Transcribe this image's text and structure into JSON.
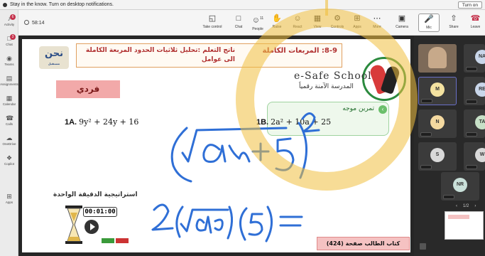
{
  "notification": {
    "text": "Stay in the know. Turn on desktop notifications.",
    "turn_on": "Turn on"
  },
  "rail": [
    {
      "label": "Activity",
      "icon": "bell-icon",
      "badge": "6"
    },
    {
      "label": "Chat",
      "icon": "chat-icon",
      "badge": "3"
    },
    {
      "label": "Teams",
      "icon": "teams-icon"
    },
    {
      "label": "Assignments",
      "icon": "assignments-icon"
    },
    {
      "label": "Calendar",
      "icon": "calendar-icon"
    },
    {
      "label": "Calls",
      "icon": "phone-icon"
    },
    {
      "label": "OneDrive",
      "icon": "cloud-icon"
    },
    {
      "label": "Copilot",
      "icon": "copilot-icon"
    },
    {
      "label": "Apps",
      "icon": "plus-icon"
    }
  ],
  "meeting": {
    "elapsed": "58:14"
  },
  "toolbar": [
    {
      "label": "Take control",
      "icon": "take-control-icon"
    },
    {
      "label": "Chat",
      "icon": "chat-icon"
    },
    {
      "label": "People",
      "icon": "people-icon",
      "count": "11"
    },
    {
      "label": "Raise",
      "icon": "hand-icon"
    },
    {
      "label": "React",
      "icon": "smile-icon"
    },
    {
      "label": "View",
      "icon": "view-icon"
    },
    {
      "label": "Controls",
      "icon": "controls-icon"
    },
    {
      "label": "Apps",
      "icon": "apps-icon"
    },
    {
      "label": "More",
      "icon": "more-icon"
    },
    {
      "label": "Camera",
      "icon": "camera-off-icon"
    },
    {
      "label": "Mic",
      "icon": "mic-icon"
    },
    {
      "label": "Share",
      "icon": "share-icon"
    },
    {
      "label": "Leave",
      "icon": "phone-leave-icon"
    }
  ],
  "slide": {
    "lesson": "8-9: المربعات الكاملة",
    "objective": "ناتج التعلم :تحليل ثلاثيات الحدود المربعة الكاملة الى عوامل",
    "logo_text": "نحن",
    "logo_sub": "مستقبل",
    "school_en": "e-Safe School",
    "school_ar": "المدرسة الآمنة رقمياً",
    "individual": "فردي",
    "guided_practice": "تمرين موجه",
    "eq1_label": "1A.",
    "eq1": "9y² + 24y + 16",
    "eq2_label": "1B.",
    "eq2": "2a² + 10a + 25",
    "strategy": "استراتيجية الدقيقة الواحدة",
    "timer": "00:01:00",
    "page_ref": "كتاب الطالب صفحة (424)"
  },
  "participants": [
    {
      "initials": "",
      "color": "#c7a98a"
    },
    {
      "initials": "NA",
      "color": "#c9d6ea"
    },
    {
      "initials": "M",
      "color": "#f4e2a0"
    },
    {
      "initials": "RE",
      "color": "#c9d6ea"
    },
    {
      "initials": "N",
      "color": "#f4d9a0"
    },
    {
      "initials": "TA",
      "color": "#c7e0c7"
    },
    {
      "initials": "S",
      "color": "#d9d9d9"
    },
    {
      "initials": "W",
      "color": "#d9d9d9"
    },
    {
      "initials": "NR",
      "color": "#c9e0d9"
    }
  ],
  "pager": {
    "text": "1/2"
  }
}
